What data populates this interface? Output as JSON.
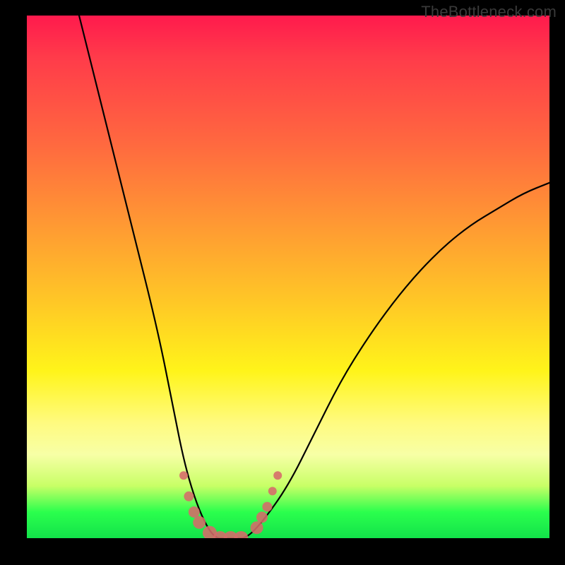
{
  "watermark": "TheBottleneck.com",
  "chart_data": {
    "type": "line",
    "title": "",
    "xlabel": "",
    "ylabel": "",
    "xlim": [
      0,
      100
    ],
    "ylim": [
      0,
      100
    ],
    "grid": false,
    "series": [
      {
        "name": "bottleneck-curve",
        "x": [
          10,
          15,
          20,
          25,
          28,
          30,
          32,
          34,
          36,
          38,
          40,
          42,
          45,
          50,
          55,
          60,
          65,
          70,
          75,
          80,
          85,
          90,
          95,
          100
        ],
        "y": [
          100,
          80,
          60,
          40,
          25,
          15,
          8,
          3,
          0,
          0,
          0,
          0,
          3,
          10,
          20,
          30,
          38,
          45,
          51,
          56,
          60,
          63,
          66,
          68
        ]
      }
    ],
    "markers": {
      "name": "highlighted-points",
      "color": "#d66a6a",
      "points": [
        {
          "x": 30,
          "y": 12,
          "r": 6
        },
        {
          "x": 31,
          "y": 8,
          "r": 7
        },
        {
          "x": 32,
          "y": 5,
          "r": 8
        },
        {
          "x": 33,
          "y": 3,
          "r": 9
        },
        {
          "x": 35,
          "y": 1,
          "r": 10
        },
        {
          "x": 37,
          "y": 0,
          "r": 10
        },
        {
          "x": 39,
          "y": 0,
          "r": 10
        },
        {
          "x": 41,
          "y": 0,
          "r": 10
        },
        {
          "x": 44,
          "y": 2,
          "r": 9
        },
        {
          "x": 45,
          "y": 4,
          "r": 8
        },
        {
          "x": 46,
          "y": 6,
          "r": 7
        },
        {
          "x": 47,
          "y": 9,
          "r": 6
        },
        {
          "x": 48,
          "y": 12,
          "r": 6
        }
      ]
    },
    "gradient_stops": [
      {
        "pos": 0,
        "color": "#ff1a4d"
      },
      {
        "pos": 25,
        "color": "#ff6a3f"
      },
      {
        "pos": 55,
        "color": "#ffc826"
      },
      {
        "pos": 78,
        "color": "#fffb80"
      },
      {
        "pos": 95,
        "color": "#2bff4d"
      },
      {
        "pos": 100,
        "color": "#12e24a"
      }
    ]
  }
}
